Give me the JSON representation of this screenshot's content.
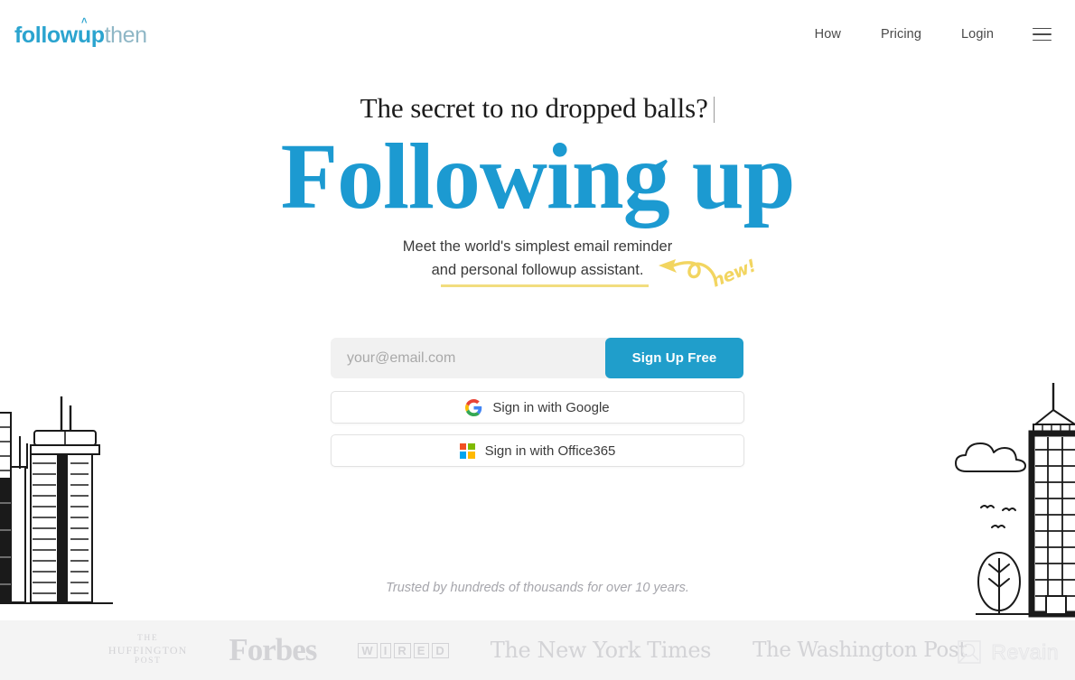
{
  "brand": {
    "logo_part1": "follow",
    "logo_u": "u",
    "logo_part2": "p",
    "logo_part3": "then",
    "accent_color": "#2ba4cf",
    "button_color": "#209ecb",
    "highlight_color": "#f2dd7e"
  },
  "nav": {
    "items": [
      {
        "label": "How"
      },
      {
        "label": "Pricing"
      },
      {
        "label": "Login"
      }
    ],
    "menu_icon": "hamburger-icon"
  },
  "hero": {
    "kicker": "The secret to no dropped balls?",
    "headline": "Following up",
    "subhead_line1": "Meet the world's simplest email reminder",
    "subhead_line2": "and personal followup assistant.",
    "annotation": "new!"
  },
  "signup": {
    "email_placeholder": "your@email.com",
    "email_value": "",
    "submit_label": "Sign Up Free",
    "google_label": "Sign in with Google",
    "office_label": "Sign in with Office365"
  },
  "trust": {
    "text": "Trusted by hundreds of thousands for over 10 years."
  },
  "press": {
    "huffington_the": "THE",
    "huffington_main": "HUFFINGTON",
    "huffington_post": "POST",
    "forbes": "Forbes",
    "wired_letters": [
      "W",
      "I",
      "R",
      "E",
      "D"
    ],
    "nyt": "The New York Times",
    "wapo": "The Washington Post"
  },
  "watermark": {
    "label": "Revain"
  }
}
